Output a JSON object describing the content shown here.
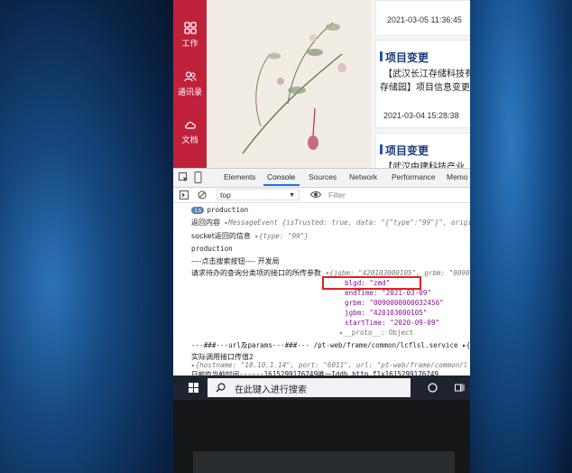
{
  "sidebar": {
    "items": [
      {
        "label": "工作",
        "icon": "grid-icon"
      },
      {
        "label": "通讯录",
        "icon": "contacts-icon"
      },
      {
        "label": "文档",
        "icon": "cloud-icon"
      }
    ]
  },
  "cards": {
    "time1": "2021-03-05 11:36:45",
    "card2": {
      "title": "项目变更",
      "line1": "【武汉长江存储科技有",
      "line2": "存储园】项目信息变更",
      "time": "2021-03-04 15:28:38"
    },
    "card3": {
      "title": "项目变更",
      "line1": "【武汉中建科技产业"
    }
  },
  "devtools": {
    "tabs": [
      "Elements",
      "Console",
      "Sources",
      "Network",
      "Performance",
      "Memo"
    ],
    "active_tab": "Console",
    "context": "top",
    "filter_placeholder": "Filter"
  },
  "console": {
    "lines": {
      "l1_badge": "is",
      "l1": "production",
      "l2a": "返回内容",
      "l2b": "▸MessageEvent {isTrusted: true, data: \"{\"type\":\"99\"}\", origi",
      "l3a": "socket返回的信息",
      "l3b": "▸{type: \"99\"}",
      "l4": "production",
      "l5": "----点击搜索按钮---- 开发局",
      "l6a": "请求待办的查询分类项的接口的所传参数",
      "l6b": "▾{jgbm: \"420103000105\", grbm: \"0090",
      "l7": "blgd: \"zmd\"",
      "l8": "endTime: \"2021-03-09\"",
      "l9": "grbm: \"0090000000032456\"",
      "l10": "jgbm: \"420103000105\"",
      "l11": "startTime: \"2020-09-09\"",
      "l12": "▸__proto__: Object",
      "l13": "---###---url及params---###--- /pt-web/frame/common/lcflsl.service ▸{",
      "l14": "实际调用接口传值2",
      "l15": "▸{hostname: \"10.10.1.14\", port: \"6011\", url: \"pt-web/frame/common/l",
      "l16": "日前的当前时间------1615299176749唯一Iddb_http_f1x1615299176749"
    }
  },
  "taskbar": {
    "search_placeholder": "在此键入进行搜索"
  }
}
